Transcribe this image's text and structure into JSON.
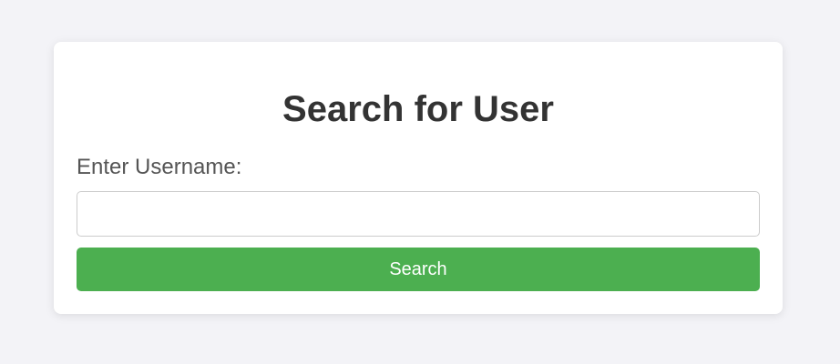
{
  "form": {
    "title": "Search for User",
    "username_label": "Enter Username:",
    "username_value": "",
    "username_placeholder": "",
    "search_label": "Search"
  },
  "colors": {
    "background": "#f3f3f7",
    "card": "#ffffff",
    "accent": "#4caf50",
    "title_text": "#333333"
  }
}
